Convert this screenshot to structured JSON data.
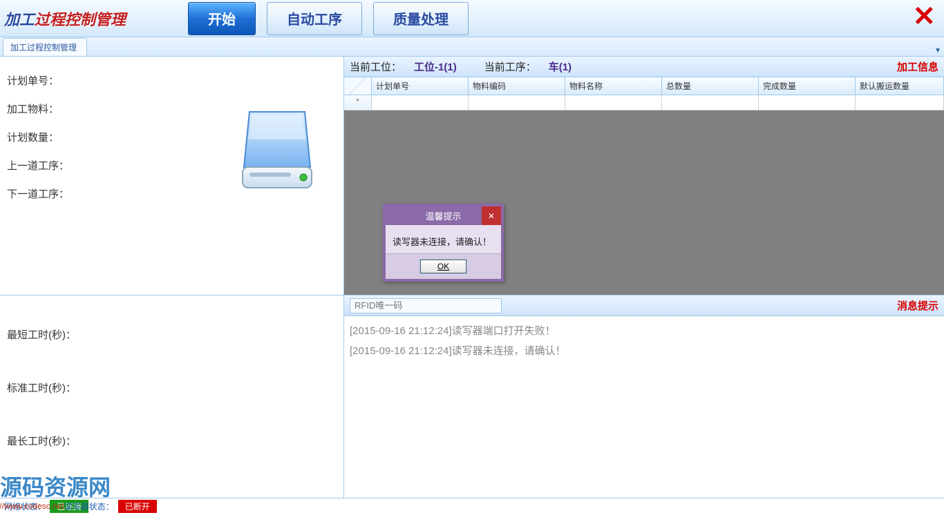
{
  "header": {
    "title_a": "加工",
    "title_b": "过程控制管理",
    "btn_start": "开始",
    "btn_auto": "自动工序",
    "btn_quality": "质量处理",
    "close": "✕"
  },
  "tab": {
    "label": "加工过程控制管理"
  },
  "left": {
    "plan_no": "计划单号：",
    "material": "加工物料：",
    "plan_qty": "计划数量：",
    "prev_op": "上一道工序：",
    "next_op": "下一道工序：",
    "min_time": "最短工时(秒)：",
    "std_time": "标准工时(秒)：",
    "max_time": "最长工时(秒)：",
    "watermark": "源码资源网"
  },
  "station": {
    "pos_label": "当前工位：",
    "pos_value": "工位-1(1)",
    "op_label": "当前工序：",
    "op_value": "车(1)",
    "info_label": "加工信息"
  },
  "grid": {
    "cols": [
      "",
      "计划单号",
      "物料编码",
      "物料名称",
      "总数量",
      "完成数量",
      "默认搬运数量"
    ],
    "new_marker": "*"
  },
  "rfid": {
    "placeholder": "RFID唯一码",
    "msg_label": "消息提示"
  },
  "messages": [
    "[2015-09-16 21:12:24]读写器端口打开失败！",
    "[2015-09-16 21:12:24]读写器未连接，请确认！"
  ],
  "status": {
    "net_label": "网络状态：",
    "net_value": "已连接",
    "rdr_label": "读写器状态：",
    "rdr_value": "已断开",
    "site": "http://www.codesc.net"
  },
  "dialog": {
    "title": "温馨提示",
    "body": "读写器未连接，请确认！",
    "ok": "OK"
  }
}
